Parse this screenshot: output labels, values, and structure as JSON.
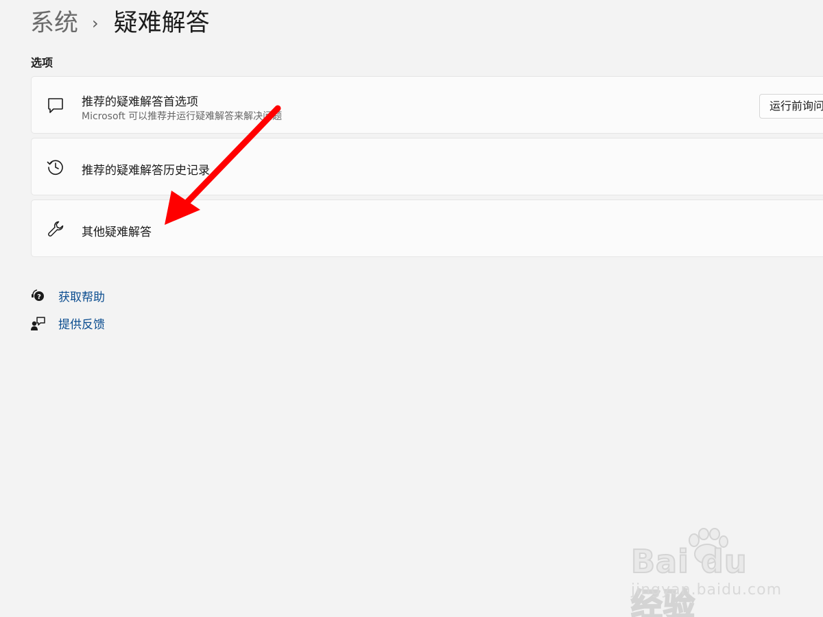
{
  "breadcrumb": {
    "parent": "系统",
    "separator": "›",
    "current": "疑难解答"
  },
  "section": {
    "title": "选项"
  },
  "cards": [
    {
      "icon": "chat-bubble-icon",
      "title": "推荐的疑难解答首选项",
      "description": "Microsoft 可以推荐并运行疑难解答来解决问题",
      "button_label": "运行前询问"
    },
    {
      "icon": "history-icon",
      "title": "推荐的疑难解答历史记录"
    },
    {
      "icon": "wrench-icon",
      "title": "其他疑难解答"
    }
  ],
  "links": [
    {
      "icon": "help-icon",
      "label": "获取帮助"
    },
    {
      "icon": "feedback-icon",
      "label": "提供反馈"
    }
  ],
  "watermark": {
    "brand": "Bai du 经验",
    "url": "jingyan.baidu.com"
  },
  "colors": {
    "background": "#f3f3f3",
    "card": "#fbfbfb",
    "link": "#0a4c8f",
    "annotation_arrow": "#ff0000"
  }
}
